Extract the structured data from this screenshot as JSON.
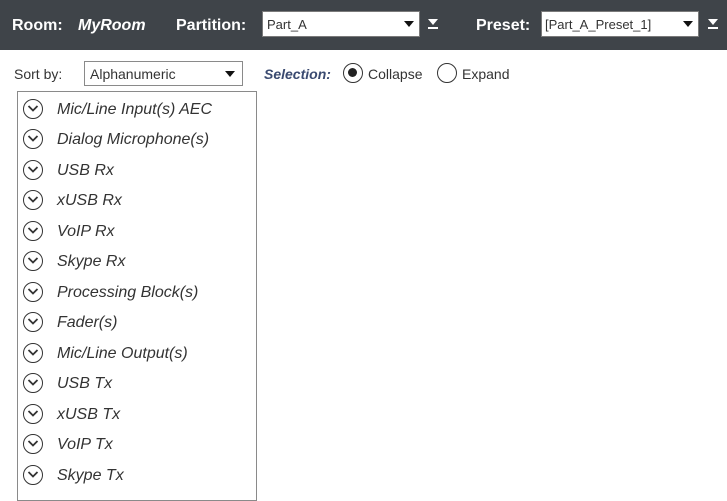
{
  "header": {
    "room_label": "Room:",
    "room_name": "MyRoom",
    "partition_label": "Partition:",
    "partition_value": "Part_A",
    "preset_label": "Preset:",
    "preset_value": "[Part_A_Preset_1]",
    "background_color": "#3f4449"
  },
  "sort": {
    "label": "Sort by:",
    "value": "Alphanumeric"
  },
  "selection": {
    "label": "Selection:",
    "options": [
      {
        "label": "Collapse",
        "selected": true
      },
      {
        "label": "Expand",
        "selected": false
      }
    ]
  },
  "groups": [
    {
      "label": "Mic/Line Input(s) AEC",
      "icon": "chevron-down-circle-icon"
    },
    {
      "label": "Dialog Microphone(s)",
      "icon": "chevron-down-circle-icon"
    },
    {
      "label": "USB Rx",
      "icon": "chevron-down-circle-icon"
    },
    {
      "label": "xUSB Rx",
      "icon": "chevron-down-circle-icon"
    },
    {
      "label": "VoIP Rx",
      "icon": "chevron-down-circle-icon"
    },
    {
      "label": "Skype Rx",
      "icon": "chevron-down-circle-icon"
    },
    {
      "label": "Processing Block(s)",
      "icon": "chevron-down-circle-icon"
    },
    {
      "label": "Fader(s)",
      "icon": "chevron-down-circle-icon"
    },
    {
      "label": "Mic/Line Output(s)",
      "icon": "chevron-down-circle-icon"
    },
    {
      "label": "USB Tx",
      "icon": "chevron-down-circle-icon"
    },
    {
      "label": "xUSB Tx",
      "icon": "chevron-down-circle-icon"
    },
    {
      "label": "VoIP Tx",
      "icon": "chevron-down-circle-icon"
    },
    {
      "label": "Skype Tx",
      "icon": "chevron-down-circle-icon"
    }
  ]
}
